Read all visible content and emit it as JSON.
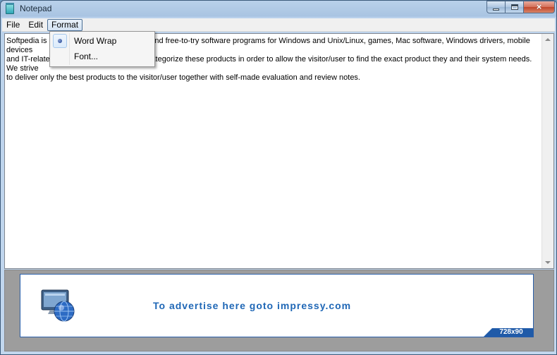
{
  "window": {
    "title": "Notepad",
    "icon": "notepad-icon",
    "controls": {
      "minimize": "minimize-icon",
      "maximize": "maximize-icon",
      "close": "×"
    }
  },
  "menubar": {
    "items": [
      {
        "label": "File",
        "active": false
      },
      {
        "label": "Edit",
        "active": false
      },
      {
        "label": "Format",
        "active": true
      }
    ]
  },
  "format_menu": {
    "items": [
      {
        "label": "Word Wrap",
        "checked": true
      },
      {
        "label": "Font...",
        "checked": false
      }
    ]
  },
  "editor": {
    "text_lines": [
      "Softpedia is a library of over 400,000 free and free-to-try software programs for Windows and Unix/Linux, games, Mac software, Windows drivers, mobile devices",
      "and IT-related articles. Softpedia aims to categorize these products in order to allow the visitor/user to find the exact product they and their system needs. We strive",
      "to deliver only the best products to the visitor/user together with self-made evaluation and review notes."
    ]
  },
  "ad": {
    "text": "To advertise here goto impressy.com",
    "size_label": "728x90",
    "colors": {
      "accent": "#1f67b6",
      "border": "#2a5ea8"
    }
  }
}
